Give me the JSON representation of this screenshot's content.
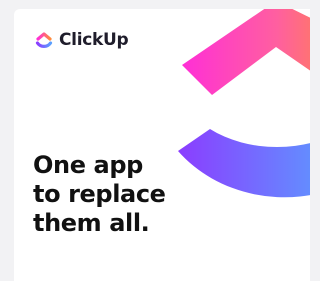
{
  "brand": {
    "name": "ClickUp",
    "logo_icon": "clickup-logo-icon"
  },
  "ad": {
    "headline": "One app\nto replace\nthem all."
  },
  "colors": {
    "chevron_start": "#ff2fd6",
    "chevron_end": "#ff8a3d",
    "arc_start": "#8b3dff",
    "arc_end": "#5aa0ff",
    "headline": "#111111"
  }
}
